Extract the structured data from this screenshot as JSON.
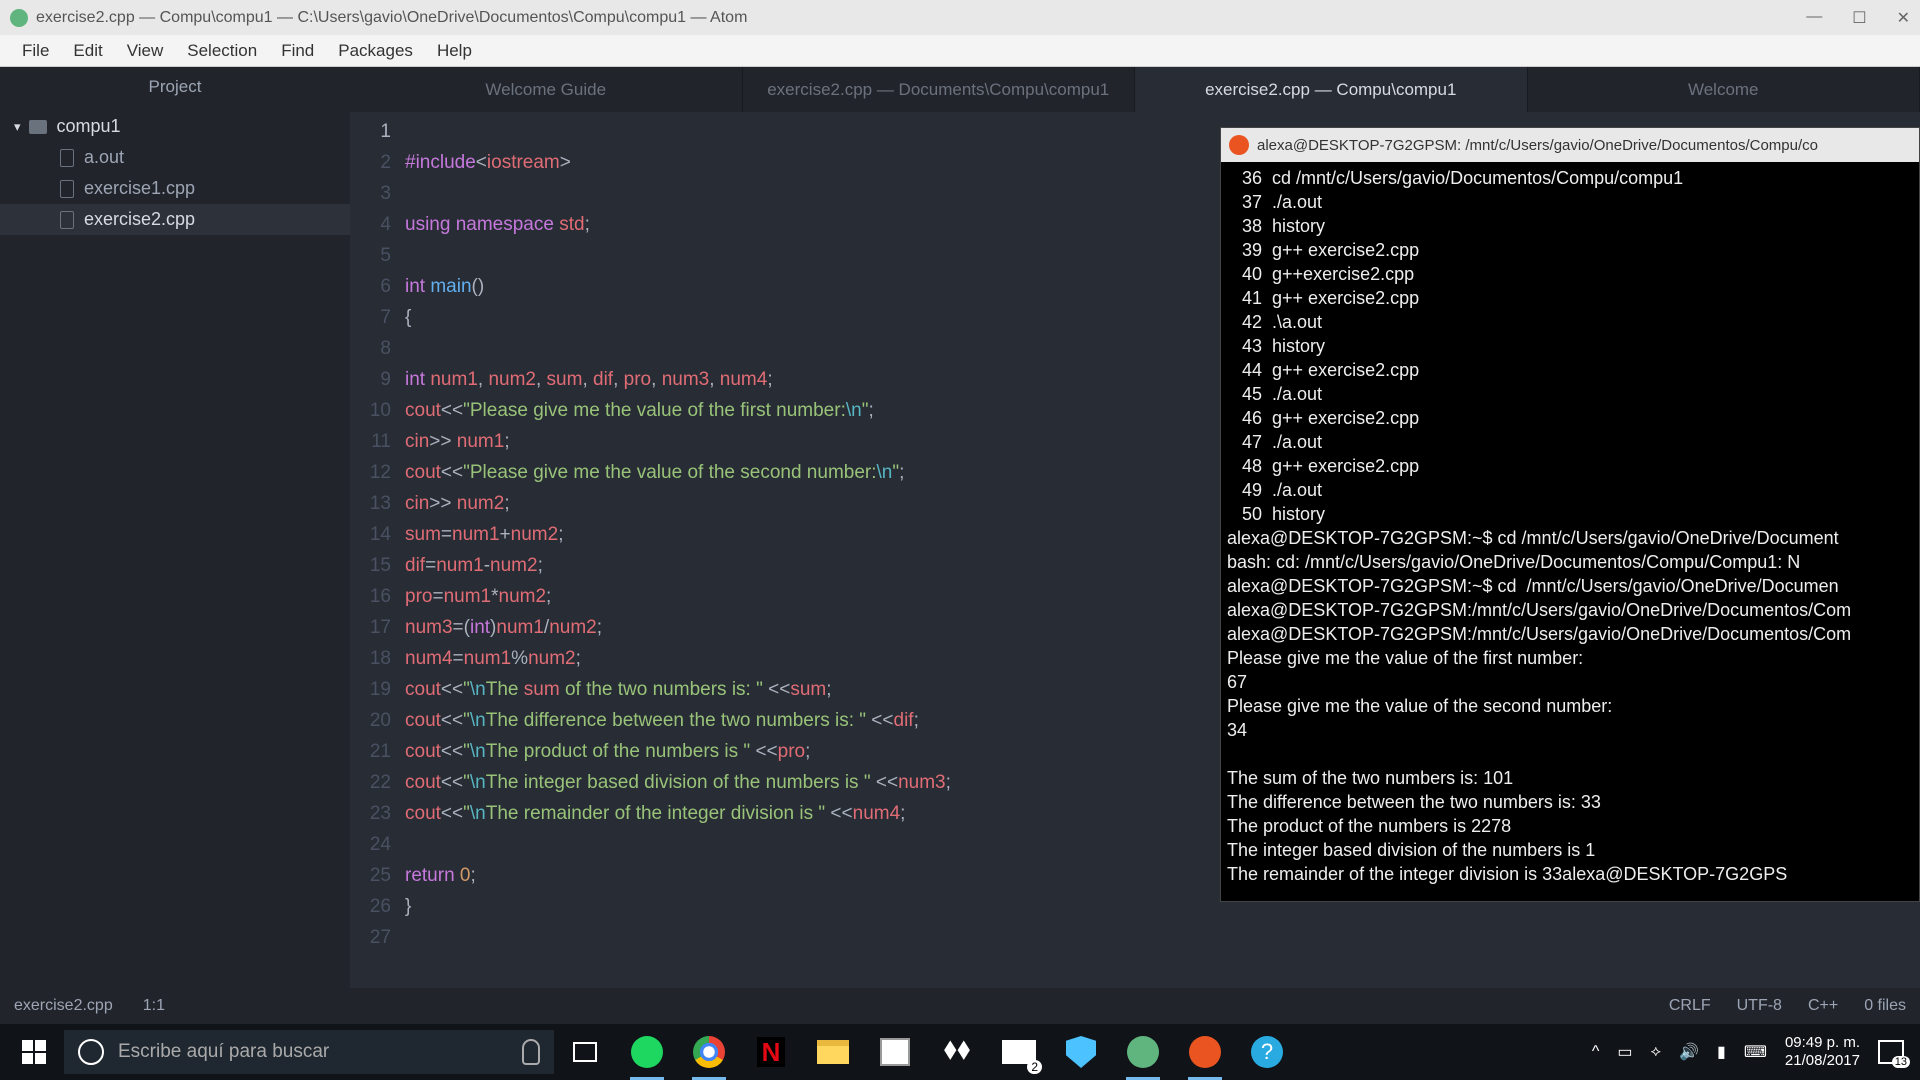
{
  "window": {
    "title": "exercise2.cpp — Compu\\compu1 — C:\\Users\\gavio\\OneDrive\\Documentos\\Compu\\compu1 — Atom"
  },
  "menu": {
    "items": [
      "File",
      "Edit",
      "View",
      "Selection",
      "Find",
      "Packages",
      "Help"
    ]
  },
  "sidebar": {
    "title": "Project",
    "root": "compu1",
    "files": [
      "a.out",
      "exercise1.cpp",
      "exercise2.cpp"
    ]
  },
  "tabs": {
    "items": [
      "Welcome Guide",
      "exercise2.cpp — Documents\\Compu\\compu1",
      "exercise2.cpp — Compu\\compu1",
      "Welcome"
    ],
    "active": 2
  },
  "code": {
    "lines": [
      {
        "n": 1,
        "raw": ""
      },
      {
        "n": 2,
        "raw": "#include<iostream>"
      },
      {
        "n": 3,
        "raw": ""
      },
      {
        "n": 4,
        "raw": "using namespace std;"
      },
      {
        "n": 5,
        "raw": ""
      },
      {
        "n": 6,
        "raw": "int main()"
      },
      {
        "n": 7,
        "raw": "{"
      },
      {
        "n": 8,
        "raw": ""
      },
      {
        "n": 9,
        "raw": "int num1, num2, sum, dif, pro, num3, num4;"
      },
      {
        "n": 10,
        "raw": "cout<<\"Please give me the value of the first number:\\n\";"
      },
      {
        "n": 11,
        "raw": "cin>> num1;"
      },
      {
        "n": 12,
        "raw": "cout<<\"Please give me the value of the second number:\\n\";"
      },
      {
        "n": 13,
        "raw": "cin>> num2;"
      },
      {
        "n": 14,
        "raw": "sum=num1+num2;"
      },
      {
        "n": 15,
        "raw": "dif=num1-num2;"
      },
      {
        "n": 16,
        "raw": "pro=num1*num2;"
      },
      {
        "n": 17,
        "raw": "num3=(int)num1/num2;"
      },
      {
        "n": 18,
        "raw": "num4=num1%num2;"
      },
      {
        "n": 19,
        "raw": "cout<<\"\\nThe sum of the two numbers is: \" <<sum;"
      },
      {
        "n": 20,
        "raw": "cout<<\"\\nThe difference between the two numbers is: \" <<dif;"
      },
      {
        "n": 21,
        "raw": "cout<<\"\\nThe product of the numbers is \" <<pro;"
      },
      {
        "n": 22,
        "raw": "cout<<\"\\nThe integer based division of the numbers is \" <<num3;"
      },
      {
        "n": 23,
        "raw": "cout<<\"\\nThe remainder of the integer division is \" <<num4;"
      },
      {
        "n": 24,
        "raw": ""
      },
      {
        "n": 25,
        "raw": "return 0;"
      },
      {
        "n": 26,
        "raw": "}"
      },
      {
        "n": 27,
        "raw": ""
      }
    ]
  },
  "terminal": {
    "title": "alexa@DESKTOP-7G2GPSM: /mnt/c/Users/gavio/OneDrive/Documentos/Compu/co",
    "lines": [
      "   36  cd /mnt/c/Users/gavio/Documentos/Compu/compu1",
      "   37  ./a.out",
      "   38  history",
      "   39  g++ exercise2.cpp",
      "   40  g++exercise2.cpp",
      "   41  g++ exercise2.cpp",
      "   42  .\\a.out",
      "   43  history",
      "   44  g++ exercise2.cpp",
      "   45  ./a.out",
      "   46  g++ exercise2.cpp",
      "   47  ./a.out",
      "   48  g++ exercise2.cpp",
      "   49  ./a.out",
      "   50  history",
      "alexa@DESKTOP-7G2GPSM:~$ cd /mnt/c/Users/gavio/OneDrive/Document",
      "bash: cd: /mnt/c/Users/gavio/OneDrive/Documentos/Compu/Compu1: N",
      "alexa@DESKTOP-7G2GPSM:~$ cd  /mnt/c/Users/gavio/OneDrive/Documen",
      "alexa@DESKTOP-7G2GPSM:/mnt/c/Users/gavio/OneDrive/Documentos/Com",
      "alexa@DESKTOP-7G2GPSM:/mnt/c/Users/gavio/OneDrive/Documentos/Com",
      "Please give me the value of the first number:",
      "67",
      "Please give me the value of the second number:",
      "34",
      "",
      "The sum of the two numbers is: 101",
      "The difference between the two numbers is: 33",
      "The product of the numbers is 2278",
      "The integer based division of the numbers is 1",
      "The remainder of the integer division is 33alexa@DESKTOP-7G2GPS"
    ]
  },
  "status": {
    "file": "exercise2.cpp",
    "pos": "1:1",
    "eol": "CRLF",
    "encoding": "UTF-8",
    "lang": "C++",
    "files": "0 files"
  },
  "taskbar": {
    "search_placeholder": "Escribe aquí para buscar",
    "time": "09:49 p. m.",
    "date": "21/08/2017",
    "notif_count": "13",
    "mail_badge": "2"
  }
}
